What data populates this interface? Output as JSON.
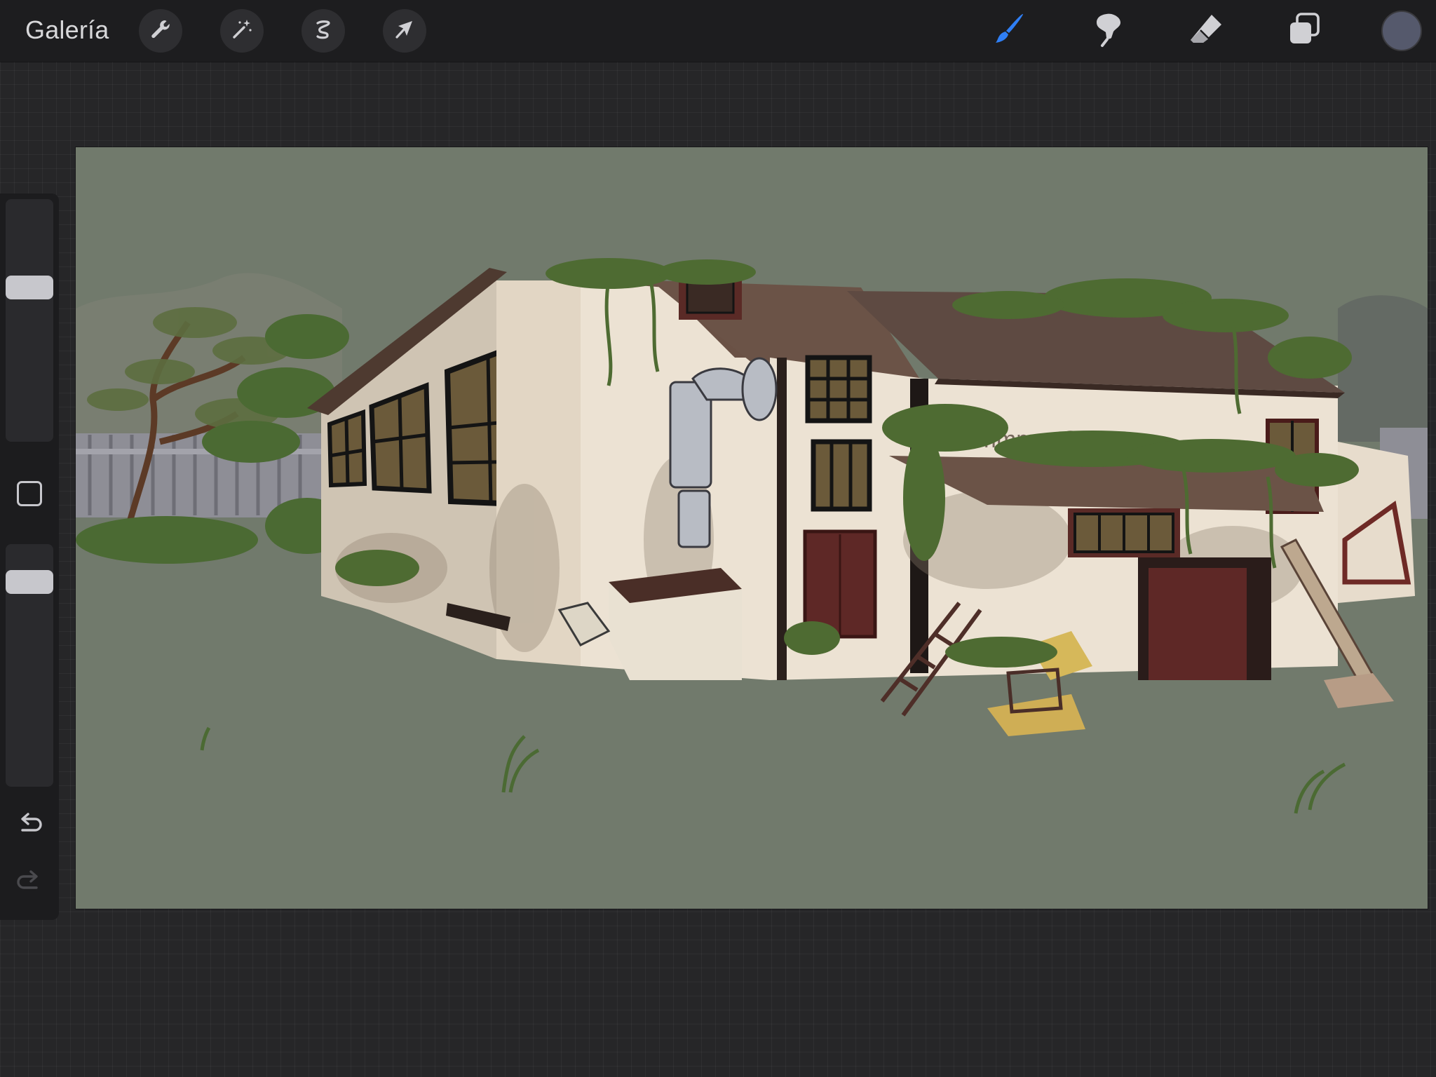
{
  "toolbar": {
    "gallery_label": "Galería",
    "left_tools": [
      "wrench-icon",
      "magic-wand-icon",
      "selection-icon",
      "transform-arrow-icon"
    ],
    "right_tools": [
      "brush-icon",
      "smudge-icon",
      "eraser-icon",
      "layers-icon"
    ],
    "active_tool": "brush",
    "active_color": "#55596c",
    "accent_color": "#2f7ff5"
  },
  "sidebar": {
    "size_slider_level": 0.35,
    "opacity_slider_level": 0.12,
    "modifier_icon": "square-modifier-icon",
    "undo_icon": "undo-icon",
    "redo_icon": "redo-icon",
    "redo_enabled": false
  },
  "canvas": {
    "background_color": "#717a6c",
    "artwork": "illustration-of-abandoned-building-with-vines",
    "wall_sign_text": "Hmmm... S.L"
  }
}
